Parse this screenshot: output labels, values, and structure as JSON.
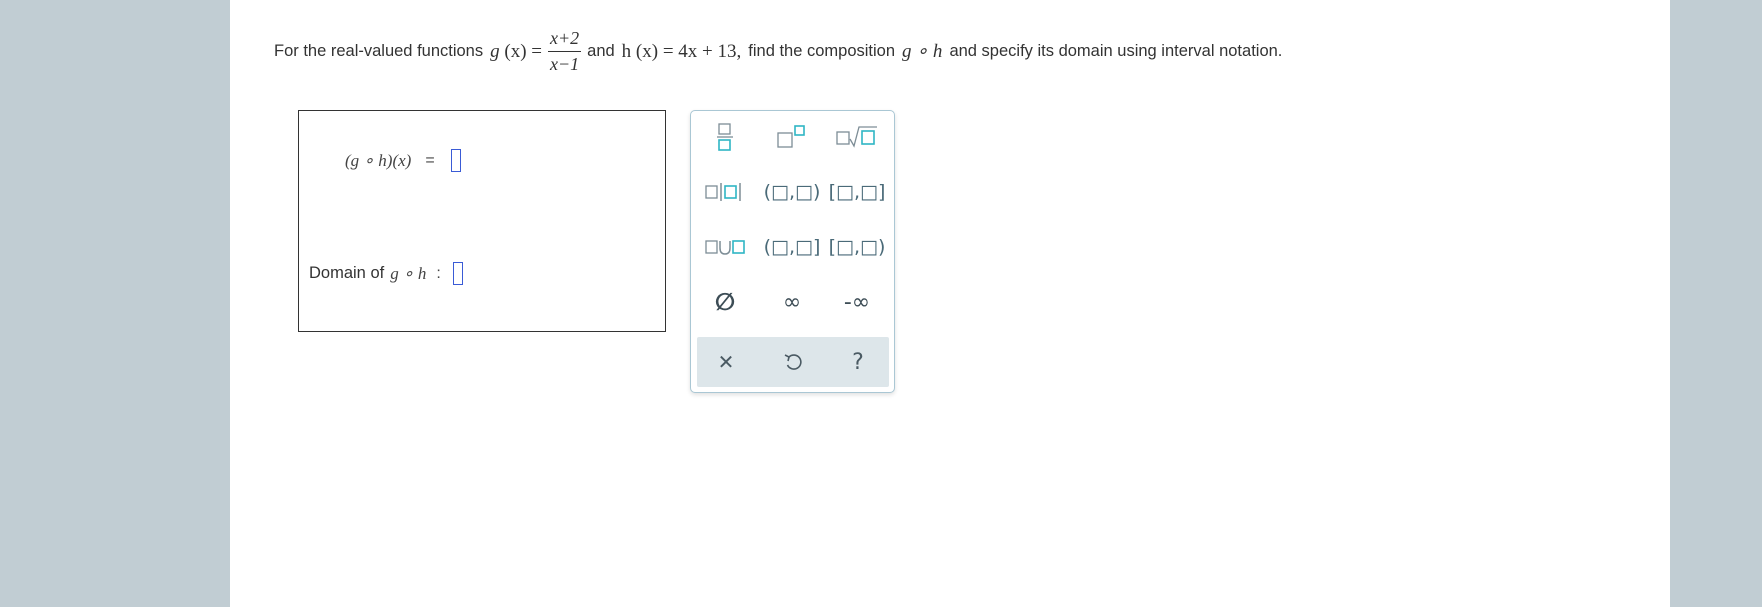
{
  "question": {
    "prefix": "For the real-valued functions",
    "g_name": "g",
    "g_arg": "(x) =",
    "g_num": "x+2",
    "g_den": "x−1",
    "and_text": "and",
    "h_def": "h (x) = 4x + 13,",
    "middle": "find the composition",
    "composition": "g ∘ h",
    "suffix": "and specify its domain using interval notation."
  },
  "answers": {
    "composition_label": "(g ∘ h)(x)",
    "equals": "=",
    "domain_label": "Domain of",
    "domain_fn": "g ∘ h",
    "colon": ":"
  },
  "palette": {
    "buttons": [
      {
        "name": "fraction",
        "icon": "fraction-icon"
      },
      {
        "name": "superscript",
        "icon": "superscript-icon"
      },
      {
        "name": "nth-root",
        "icon": "nth-root-icon"
      },
      {
        "name": "absolute-value",
        "icon": "absolute-value-icon"
      },
      {
        "name": "open-interval",
        "label": "(□,□)"
      },
      {
        "name": "closed-interval",
        "label": "[□,□]"
      },
      {
        "name": "union",
        "icon": "union-icon"
      },
      {
        "name": "half-open-right-closed",
        "label": "(□,□]"
      },
      {
        "name": "half-open-left-closed",
        "label": "[□,□)"
      },
      {
        "name": "empty-set",
        "label": "∅"
      },
      {
        "name": "infinity",
        "label": "∞"
      },
      {
        "name": "negative-infinity",
        "label": "-∞"
      }
    ],
    "footer": [
      {
        "name": "clear",
        "label": "✕"
      },
      {
        "name": "undo",
        "icon": "undo-icon"
      },
      {
        "name": "help",
        "label": "?"
      }
    ],
    "accent": "#2fb6c4",
    "border": "#aac7d4"
  }
}
